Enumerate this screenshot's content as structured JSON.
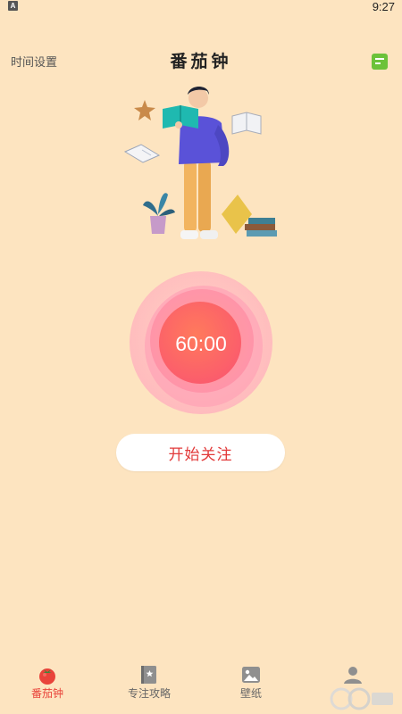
{
  "status": {
    "indicator": "A",
    "time": "9:27"
  },
  "header": {
    "left_link": "时间设置",
    "title": "番茄钟",
    "menu_icon": "list-icon"
  },
  "timer": {
    "display": "60:00"
  },
  "actions": {
    "start_label": "开始关注"
  },
  "tabs": [
    {
      "label": "番茄钟",
      "icon": "tomato-icon",
      "active": true
    },
    {
      "label": "专注攻略",
      "icon": "book-icon",
      "active": false
    },
    {
      "label": "壁纸",
      "icon": "image-icon",
      "active": false
    },
    {
      "label": "",
      "icon": "user-icon",
      "active": false
    }
  ],
  "colors": {
    "background": "#fde4c0",
    "accent": "#e9433a",
    "menu_green": "#6cc23a",
    "timer_core": "#fb6b6b"
  }
}
